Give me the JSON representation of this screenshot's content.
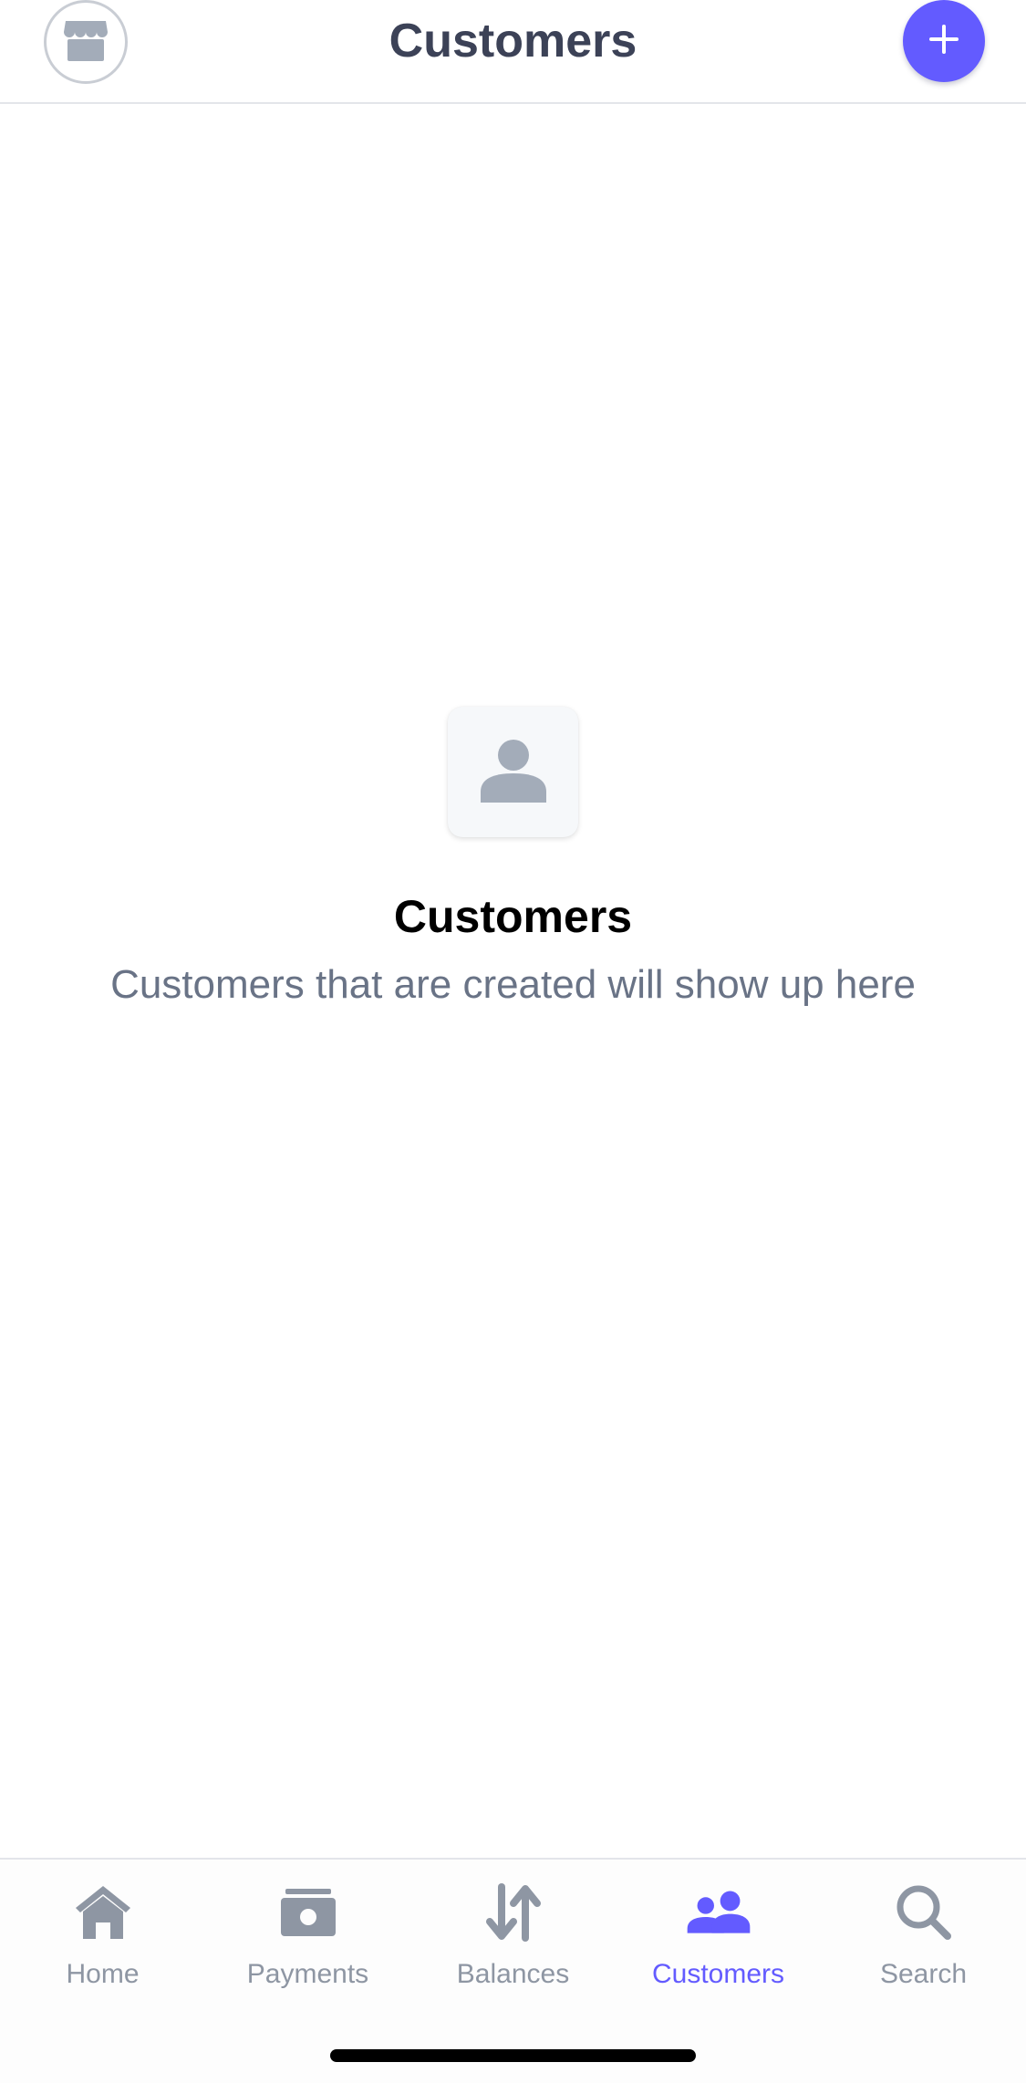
{
  "header": {
    "title": "Customers",
    "account_icon": "storefront-icon",
    "add_icon": "plus-icon"
  },
  "empty_state": {
    "icon": "person-icon",
    "title": "Customers",
    "subtitle": "Customers that are created will show up here"
  },
  "tabs": [
    {
      "label": "Home",
      "icon": "home-icon",
      "active": false
    },
    {
      "label": "Payments",
      "icon": "payments-icon",
      "active": false
    },
    {
      "label": "Balances",
      "icon": "transfer-arrows-icon",
      "active": false
    },
    {
      "label": "Customers",
      "icon": "customers-icon",
      "active": true
    },
    {
      "label": "Search",
      "icon": "search-icon",
      "active": false
    }
  ],
  "colors": {
    "accent": "#635bff",
    "title_text": "#3c4257",
    "subtitle_text": "#697386",
    "inactive_tab": "#8e96a3",
    "icon_gray": "#a3acb9"
  }
}
